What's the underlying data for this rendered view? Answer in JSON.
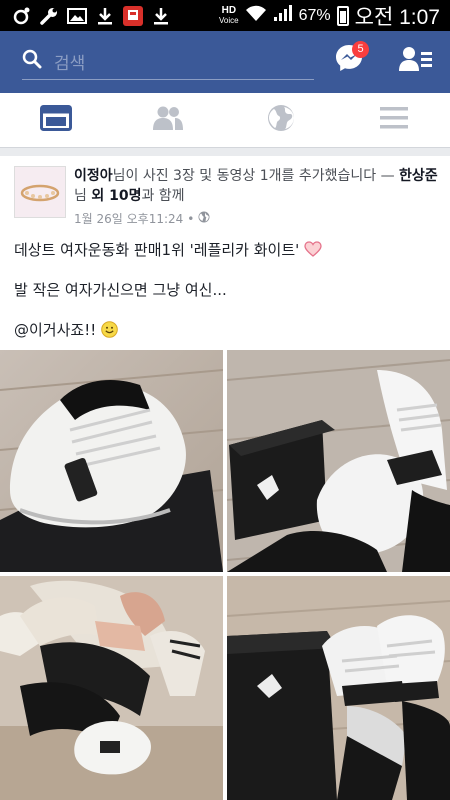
{
  "status_bar": {
    "hd_label": "HD",
    "voice_label": "Voice",
    "battery": "67%",
    "time": "오전 1:07",
    "icons": [
      "circle-dots-icon",
      "wrench-icon",
      "image-icon",
      "download-icon",
      "app-red-icon",
      "download-icon"
    ]
  },
  "header": {
    "search_placeholder": "검색",
    "messenger_badge": "5",
    "colors": {
      "bar": "#3b5998",
      "badge": "#fa3e3e"
    }
  },
  "tabs": [
    {
      "name": "news-feed",
      "icon": "newsfeed-icon",
      "active": true
    },
    {
      "name": "friends",
      "icon": "friends-icon",
      "active": false
    },
    {
      "name": "notifications",
      "icon": "globe-icon",
      "active": false
    },
    {
      "name": "more",
      "icon": "menu-icon",
      "active": false
    }
  ],
  "post": {
    "author": "이정아",
    "action_text": "님이 사진 3장 및 동영상 1개를 추가했습니다 —",
    "tagged": "한상준",
    "tagged_suffix": "님",
    "others": "외 10명",
    "with_text": "과 함께",
    "timestamp": "1월 26일 오후11:24",
    "line1": "데상트 여자운동화 판매1위 '레플리카 화이트'",
    "line2": "발 작은 여자가신으면 그냥 여신...",
    "line3": "@이거사죠!!",
    "heart_icon": "heart-icon",
    "smile_icon": "smile-emoji-icon"
  }
}
